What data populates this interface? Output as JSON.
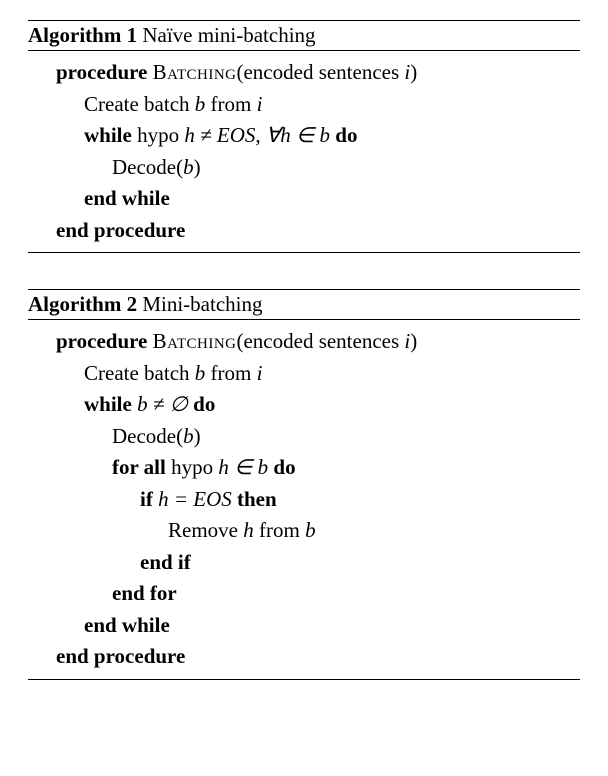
{
  "algorithms": [
    {
      "number_label": "Algorithm 1",
      "title": "Naïve mini-batching",
      "proc_name": "Batching",
      "proc_args": "(encoded sentences ",
      "proc_arg_var": "i",
      "proc_close": ")",
      "lines": [
        {
          "indent": 2,
          "parts": [
            {
              "t": "Create batch "
            },
            {
              "t": "b",
              "it": true
            },
            {
              "t": " from "
            },
            {
              "t": "i",
              "it": true
            }
          ]
        },
        {
          "indent": 2,
          "parts": [
            {
              "t": "while ",
              "kw": true
            },
            {
              "t": "hypo "
            },
            {
              "t": "h ≠ EOS",
              "it": true
            },
            {
              "t": ", "
            },
            {
              "t": "∀h ∈ b",
              "it": true
            },
            {
              "t": "  "
            },
            {
              "t": "do",
              "kw": true
            }
          ]
        },
        {
          "indent": 3,
          "parts": [
            {
              "t": "Decode("
            },
            {
              "t": "b",
              "it": true
            },
            {
              "t": ")"
            }
          ]
        },
        {
          "indent": 2,
          "parts": [
            {
              "t": "end while",
              "kw": true
            }
          ]
        }
      ]
    },
    {
      "number_label": "Algorithm 2",
      "title": "Mini-batching",
      "proc_name": "Batching",
      "proc_args": "(encoded sentences ",
      "proc_arg_var": "i",
      "proc_close": ")",
      "lines": [
        {
          "indent": 2,
          "parts": [
            {
              "t": "Create batch "
            },
            {
              "t": "b",
              "it": true
            },
            {
              "t": " from "
            },
            {
              "t": "i",
              "it": true
            }
          ]
        },
        {
          "indent": 2,
          "parts": [
            {
              "t": "while ",
              "kw": true
            },
            {
              "t": "b ≠ ∅",
              "it": true
            },
            {
              "t": " "
            },
            {
              "t": "do",
              "kw": true
            }
          ]
        },
        {
          "indent": 3,
          "parts": [
            {
              "t": "Decode("
            },
            {
              "t": "b",
              "it": true
            },
            {
              "t": ")"
            }
          ]
        },
        {
          "indent": 3,
          "parts": [
            {
              "t": "for all ",
              "kw": true
            },
            {
              "t": "hypo "
            },
            {
              "t": "h ∈ b",
              "it": true
            },
            {
              "t": " "
            },
            {
              "t": "do",
              "kw": true
            }
          ]
        },
        {
          "indent": 4,
          "parts": [
            {
              "t": "if ",
              "kw": true
            },
            {
              "t": "h = EOS",
              "it": true
            },
            {
              "t": " "
            },
            {
              "t": "then",
              "kw": true
            }
          ]
        },
        {
          "indent": 5,
          "parts": [
            {
              "t": "Remove "
            },
            {
              "t": "h",
              "it": true
            },
            {
              "t": " from "
            },
            {
              "t": "b",
              "it": true
            }
          ]
        },
        {
          "indent": 4,
          "parts": [
            {
              "t": "end if",
              "kw": true
            }
          ]
        },
        {
          "indent": 3,
          "parts": [
            {
              "t": "end for",
              "kw": true
            }
          ]
        },
        {
          "indent": 2,
          "parts": [
            {
              "t": "end while",
              "kw": true
            }
          ]
        }
      ]
    }
  ],
  "kw": {
    "procedure": "procedure",
    "end_procedure": "end procedure"
  }
}
